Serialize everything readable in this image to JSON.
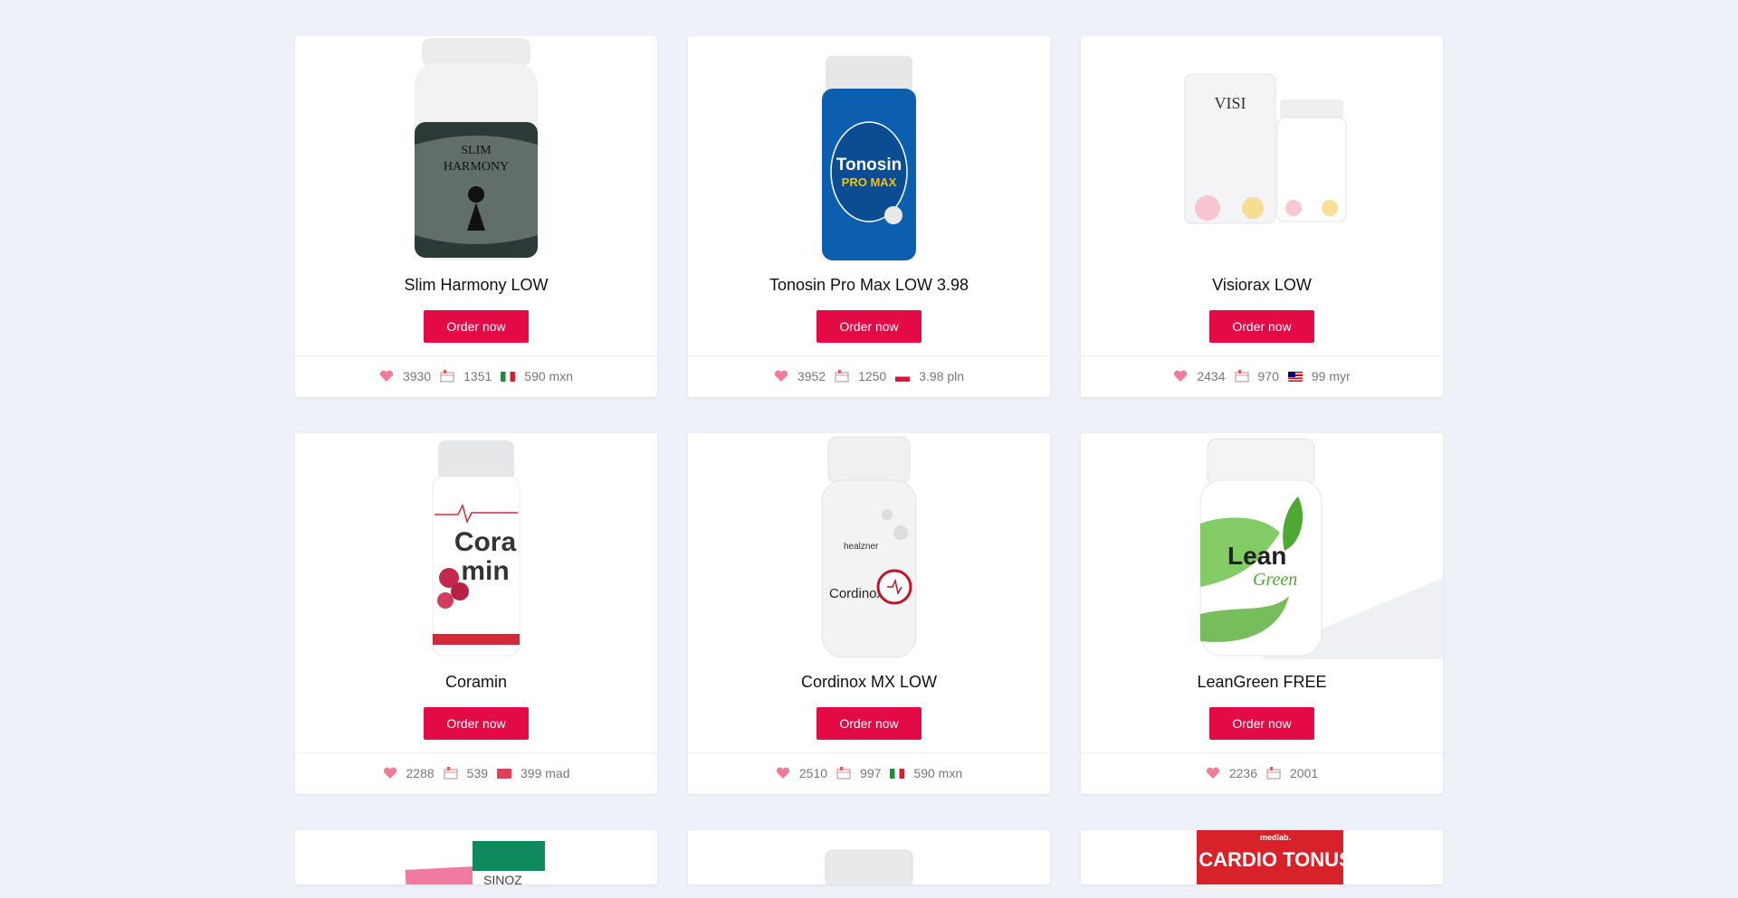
{
  "products": [
    {
      "title": "Slim Harmony LOW",
      "button": "Order now",
      "likes": "3930",
      "orders": "1351",
      "price": "590 mxn",
      "flag": "mx",
      "bottle": {
        "cap": "#e9eaec",
        "body": "#2b3a37",
        "label": "SLIM HARMONY"
      }
    },
    {
      "title": "Tonosin Pro Max LOW 3.98",
      "button": "Order now",
      "likes": "3952",
      "orders": "1250",
      "price": "3.98 pln",
      "flag": "pl",
      "bottle": {
        "cap": "#e6e7e9",
        "body": "#0b5fae",
        "label": "Tonosin PRO MAX"
      }
    },
    {
      "title": "Visiorax LOW",
      "button": "Order now",
      "likes": "2434",
      "orders": "970",
      "price": "99 myr",
      "flag": "my",
      "bottle": {
        "cap": "#f1f1f1",
        "body": "#f4f4f6",
        "label": "VISIORAX"
      }
    },
    {
      "title": "Coramin",
      "button": "Order now",
      "likes": "2288",
      "orders": "539",
      "price": "399 mad",
      "flag": "ma",
      "bottle": {
        "cap": "#e6e7e9",
        "body": "#ffffff",
        "label": "Cora min"
      }
    },
    {
      "title": "Cordinox MX LOW",
      "button": "Order now",
      "likes": "2510",
      "orders": "997",
      "price": "590 mxn",
      "flag": "mx",
      "bottle": {
        "cap": "#f0f0f0",
        "body": "#f3f3f3",
        "label": "Cordinox"
      }
    },
    {
      "title": "LeanGreen FREE",
      "button": "Order now",
      "likes": "2236",
      "orders": "2001",
      "price": "",
      "flag": "",
      "bottle": {
        "cap": "#f4f4f4",
        "body": "#ffffff",
        "label": "Lean Green"
      }
    }
  ],
  "partial_products": [
    {
      "label": "SINOZ"
    },
    {
      "label": ""
    },
    {
      "label": "CARDIO TONUS",
      "brand": "medlab."
    }
  ],
  "colors": {
    "accent": "#e30a45",
    "background": "#eef1f7"
  }
}
